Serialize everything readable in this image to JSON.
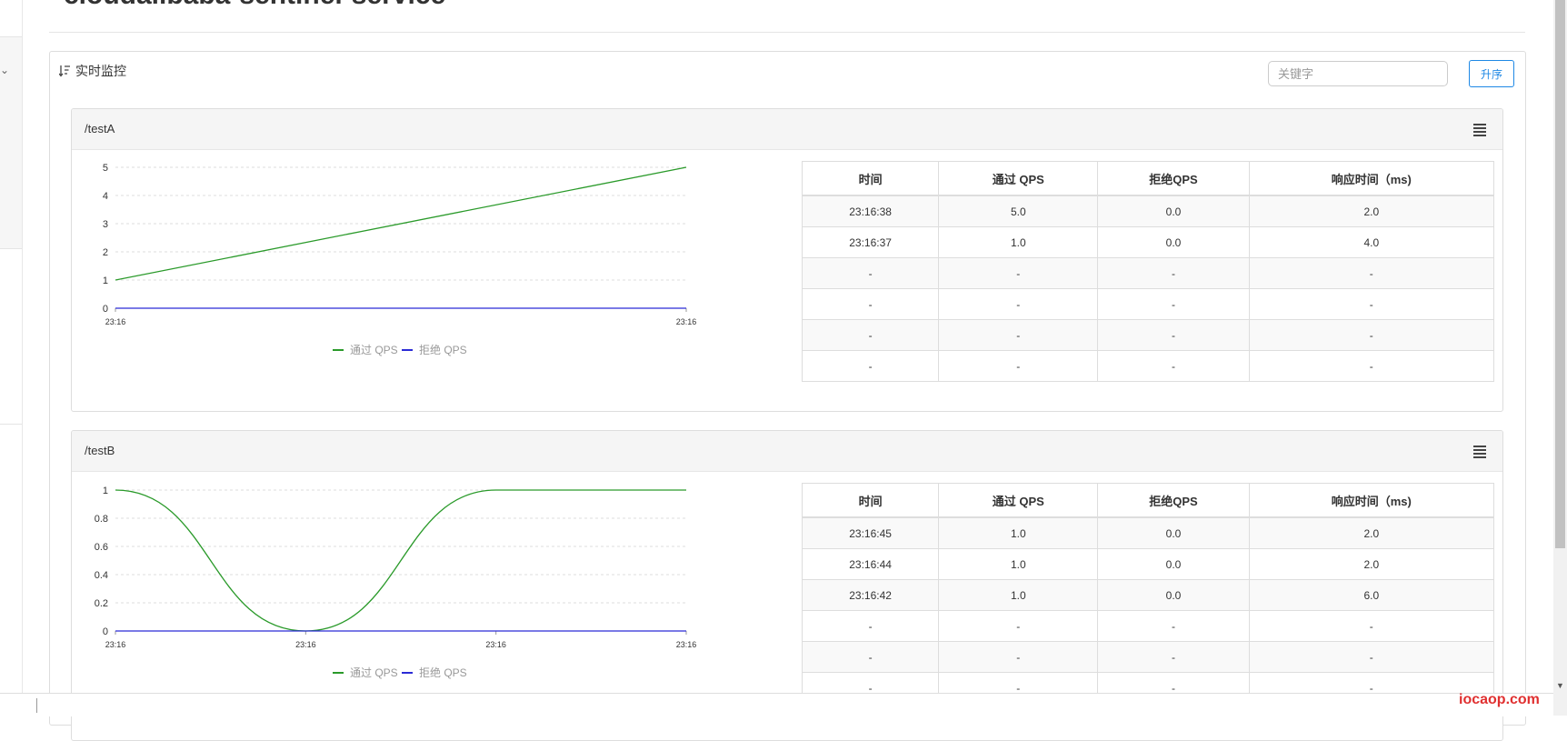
{
  "page": {
    "title": "cloudalibaba-sentinel-service"
  },
  "monitor": {
    "heading": "实时监控",
    "search_placeholder": "关键字",
    "sort_button": "升序"
  },
  "colors": {
    "pass": "#2a9a2a",
    "block": "#2b2bd6",
    "accent": "#1e88e5"
  },
  "icons": [
    "sort-icon",
    "menu-icon",
    "chevron-down-icon"
  ],
  "table_headers": [
    "时间",
    "通过 QPS",
    "拒绝QPS",
    "响应时间（ms)"
  ],
  "resources": [
    {
      "name": "/testA",
      "rows": [
        [
          "23:16:38",
          "5.0",
          "0.0",
          "2.0"
        ],
        [
          "23:16:37",
          "1.0",
          "0.0",
          "4.0"
        ],
        [
          "-",
          "-",
          "-",
          "-"
        ],
        [
          "-",
          "-",
          "-",
          "-"
        ],
        [
          "-",
          "-",
          "-",
          "-"
        ],
        [
          "-",
          "-",
          "-",
          "-"
        ]
      ],
      "chart_data": {
        "type": "line",
        "x_ticks": [
          "23:16",
          "23:16"
        ],
        "y_ticks": [
          "0",
          "1",
          "2",
          "3",
          "4",
          "5"
        ],
        "ylim": [
          0,
          5
        ],
        "smooth": false,
        "legend_position": "bottom",
        "series": [
          {
            "name": "通过 QPS",
            "color": "#2a9a2a",
            "values": [
              1,
              5
            ]
          },
          {
            "name": "拒绝 QPS",
            "color": "#2b2bd6",
            "values": [
              0,
              0
            ]
          }
        ]
      }
    },
    {
      "name": "/testB",
      "rows": [
        [
          "23:16:45",
          "1.0",
          "0.0",
          "2.0"
        ],
        [
          "23:16:44",
          "1.0",
          "0.0",
          "2.0"
        ],
        [
          "23:16:42",
          "1.0",
          "0.0",
          "6.0"
        ],
        [
          "-",
          "-",
          "-",
          "-"
        ],
        [
          "-",
          "-",
          "-",
          "-"
        ],
        [
          "-",
          "-",
          "-",
          "-"
        ]
      ],
      "chart_data": {
        "type": "line",
        "x_ticks": [
          "23:16",
          "23:16",
          "23:16",
          "23:16"
        ],
        "y_ticks": [
          "0",
          "0.2",
          "0.4",
          "0.6",
          "0.8",
          "1"
        ],
        "ylim": [
          0,
          1
        ],
        "smooth": true,
        "legend_position": "bottom",
        "series": [
          {
            "name": "通过 QPS",
            "color": "#2a9a2a",
            "values": [
              1,
              0,
              1,
              1
            ]
          },
          {
            "name": "拒绝 QPS",
            "color": "#2b2bd6",
            "values": [
              0,
              0,
              0,
              0
            ]
          }
        ]
      }
    }
  ],
  "watermark": "iocaop.com"
}
